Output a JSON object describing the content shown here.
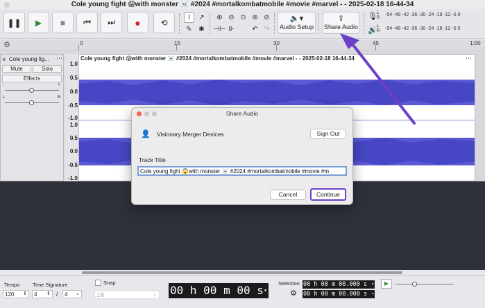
{
  "window": {
    "title": "Cole young fight 😱with monster ☠️ #2024 #mortalkombatmobile #movie #marvel - - 2025-02-18 16-44-34"
  },
  "toolbar": {
    "transport": [
      "pause-icon",
      "play-icon",
      "stop-icon",
      "skip-start-icon",
      "skip-end-icon",
      "record-icon",
      "loop-icon"
    ],
    "audio_setup_label": "Audio Setup",
    "share_audio_label": "Share Audio",
    "meter_record_labels": "-54  -48  -42  -36  -30  -24  -18  -12   -6    0",
    "meter_play_labels": "-54  -48  -42  -36  -30  -24  -18  -12   -6    0",
    "meter_channel_l": "L",
    "meter_channel_r": "R"
  },
  "ruler": {
    "ticks": [
      "0",
      "15",
      "30",
      "45",
      "1:00"
    ]
  },
  "track": {
    "name": "Cole young fig...",
    "mute_label": "Mute",
    "solo_label": "Solo",
    "effects_label": "Effects",
    "gain_minus": "-",
    "gain_plus": "+",
    "pan_left": "L",
    "pan_right": "R",
    "clip_name": "Cole young fight 😱with monster ☠️ #2024 #mortalkombatmobile #movie #marvel - - 2025-02-18 16-44-34",
    "scale_top": [
      "1.0",
      "0.5",
      "0.0",
      "-0.5",
      "-1.0"
    ],
    "scale_bottom": [
      "1.0",
      "0.5",
      "0.0",
      "-0.5",
      "-1.0"
    ]
  },
  "dialog": {
    "title": "Share Audio",
    "account_name": "Visionary Merger Devices",
    "sign_out_label": "Sign Out",
    "track_title_label": "Track Title",
    "track_title_value": "Cole young fight 😱with monster ☠️ #2024 #mortalkombatmobile #movie #m",
    "cancel_label": "Cancel",
    "continue_label": "Continue"
  },
  "bottom": {
    "tempo_label": "Tempo",
    "tempo_value": "120",
    "time_sig_label": "Time Signature",
    "time_sig_num": "4",
    "time_sig_sep": "/",
    "time_sig_den": "4",
    "snap_label": "Snap",
    "snap_value": "1/8",
    "time_display": "00 h 00 m 00 s",
    "selection_label": "Selection",
    "selection_start": "00 h 00 m 00.000 s",
    "selection_end": "00 h 00 m 00.000 s"
  },
  "colors": {
    "waveform": "#5b59d6",
    "accent": "#6a3fc9",
    "arrow": "#6a3fc9"
  }
}
